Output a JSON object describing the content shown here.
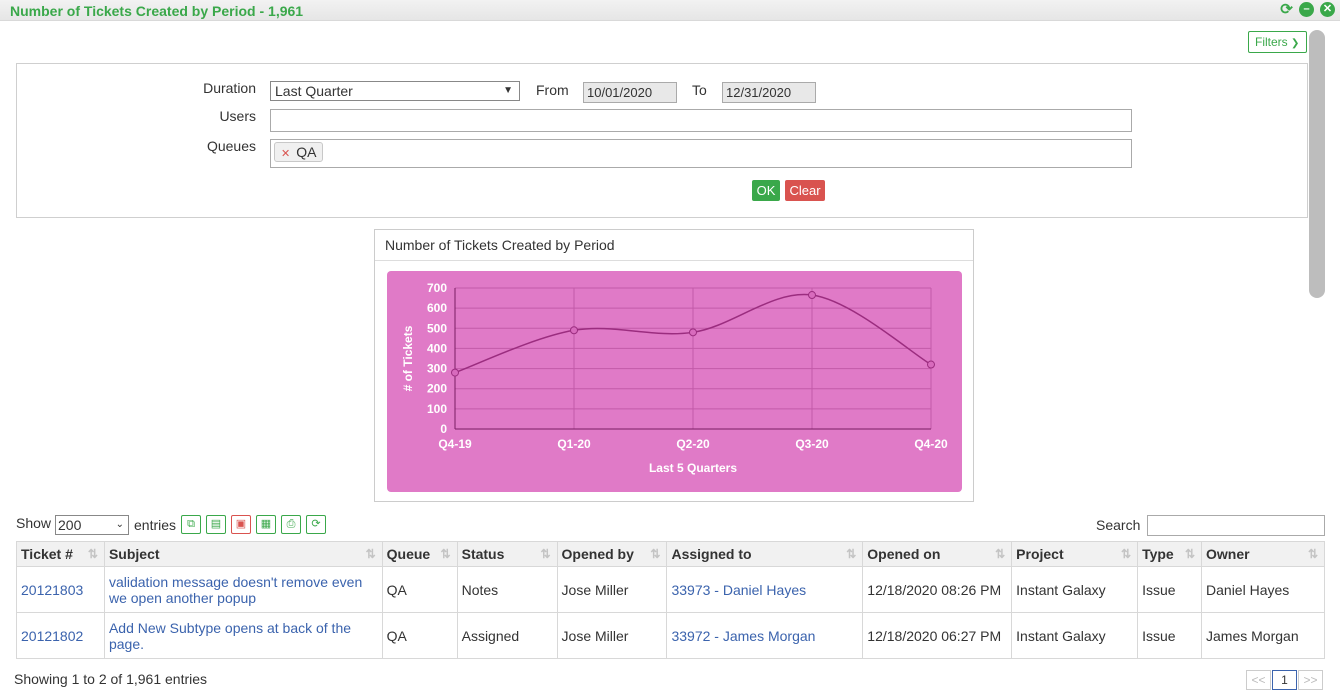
{
  "window": {
    "title": "Number of Tickets Created by Period - 1,961"
  },
  "filters": {
    "toggle_label": "Filters",
    "duration_label": "Duration",
    "duration_value": "Last Quarter",
    "from_label": "From",
    "from_value": "10/01/2020",
    "to_label": "To",
    "to_value": "12/31/2020",
    "users_label": "Users",
    "queues_label": "Queues",
    "queue_tags": [
      "QA"
    ],
    "ok_label": "OK",
    "clear_label": "Clear"
  },
  "chart_panel": {
    "header": "Number of Tickets Created by Period"
  },
  "chart_data": {
    "type": "line",
    "categories": [
      "Q4-19",
      "Q1-20",
      "Q2-20",
      "Q3-20",
      "Q4-20"
    ],
    "values": [
      280,
      490,
      480,
      665,
      320
    ],
    "xlabel": "Last 5 Quarters",
    "ylabel": "# of Tickets",
    "ylim": [
      0,
      700
    ],
    "yticks": [
      0,
      100,
      200,
      300,
      400,
      500,
      600,
      700
    ],
    "grid": true,
    "background_color": "#e07ac7",
    "line_color": "#9b2d7f"
  },
  "table_controls": {
    "show_label": "Show",
    "entries_value": "200",
    "entries_label": "entries",
    "search_label": "Search"
  },
  "table": {
    "columns": [
      "Ticket #",
      "Subject",
      "Queue",
      "Status",
      "Opened by",
      "Assigned to",
      "Opened on",
      "Project",
      "Type",
      "Owner"
    ],
    "rows": [
      {
        "ticket": "20121803",
        "subject": "validation message doesn't remove even we open another popup",
        "queue": "QA",
        "status": "Notes",
        "opened_by": "Jose Miller",
        "assigned_to": "33973 - Daniel Hayes",
        "opened_on": "12/18/2020 08:26 PM",
        "project": "Instant Galaxy",
        "type": "Issue",
        "owner": "Daniel Hayes"
      },
      {
        "ticket": "20121802",
        "subject": "Add New Subtype opens at back of the page.",
        "queue": "QA",
        "status": "Assigned",
        "opened_by": "Jose Miller",
        "assigned_to": "33972 - James Morgan",
        "opened_on": "12/18/2020 06:27 PM",
        "project": "Instant Galaxy",
        "type": "Issue",
        "owner": "James Morgan"
      }
    ]
  },
  "footer": {
    "info": "Showing 1 to 2  of 1,961 entries",
    "prev": "<<",
    "page": "1",
    "next": ">>"
  }
}
